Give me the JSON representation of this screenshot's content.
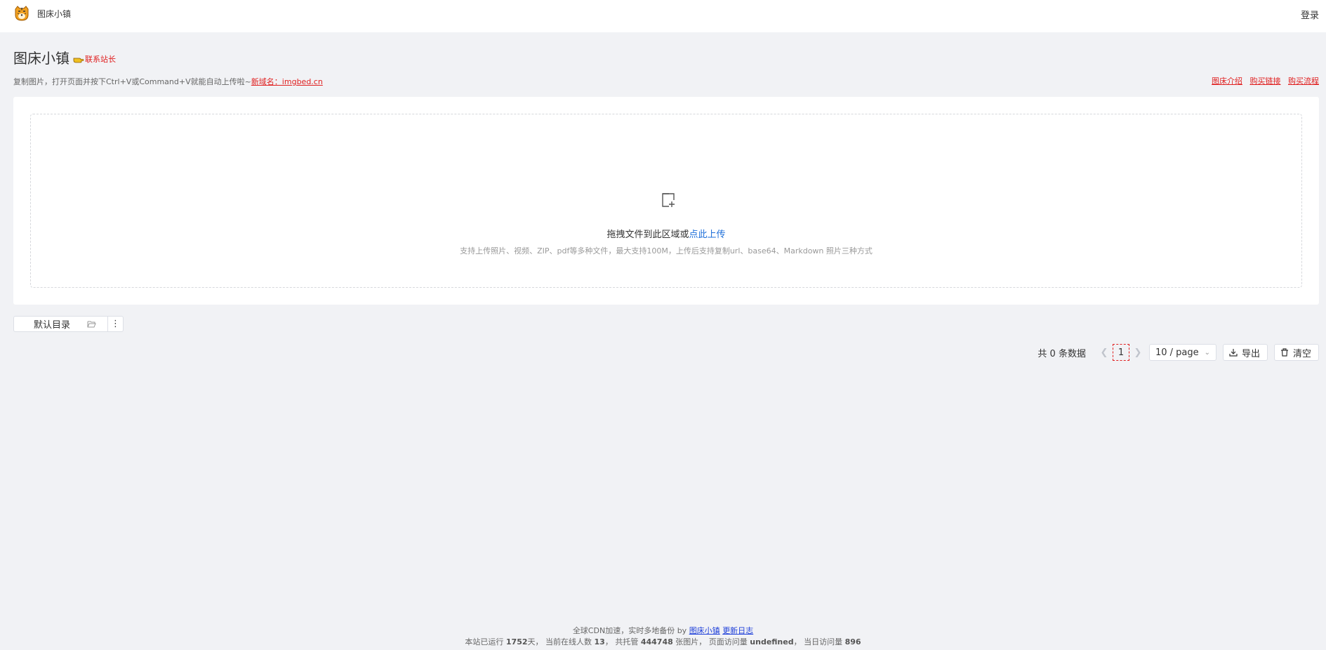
{
  "header": {
    "site_name": "图床小镇",
    "login": "登录"
  },
  "title": {
    "text": "图床小镇",
    "contact": "联系站长"
  },
  "subtitle": {
    "text": "复制图片，打开页面并按下Ctrl+V或Command+V就能自动上传啦~",
    "new_domain": "新域名：imgbed.cn"
  },
  "links": {
    "intro": "图床介绍",
    "buy_link": "购买链接",
    "buy_flow": "购买流程"
  },
  "upload": {
    "drag_text": "拖拽文件到此区域或",
    "click_text": "点此上传",
    "hint": "支持上传照片、视频、ZIP、pdf等多种文件，最大支持100M，上传后支持复制url、base64、Markdown 照片三种方式"
  },
  "folder": {
    "name": "默认目录",
    "more": "⋮"
  },
  "pagination": {
    "total": "共 0 条数据",
    "current_page": "1",
    "page_size": "10 / page",
    "export": "导出",
    "clear": "清空"
  },
  "footer": {
    "line1_prefix": "全球CDN加速，实时多地备份 by",
    "site_link": "图床小镇",
    "changelog": "更新日志",
    "run_prefix": "本站已运行",
    "run_days": "1752",
    "run_suffix": "天，",
    "online_prefix": "当前在线人数",
    "online": "13",
    "online_suffix": "，",
    "hosted_prefix": "共托管",
    "hosted": "444748",
    "hosted_suffix": "张图片，",
    "pv_prefix": "页面访问量",
    "pv": "undefined",
    "pv_suffix": "，",
    "today_prefix": "当日访问量",
    "today": "896"
  },
  "colors": {
    "accent_red": "#e02020",
    "link_blue": "#1e6fd9",
    "background": "#f1f2f5"
  }
}
